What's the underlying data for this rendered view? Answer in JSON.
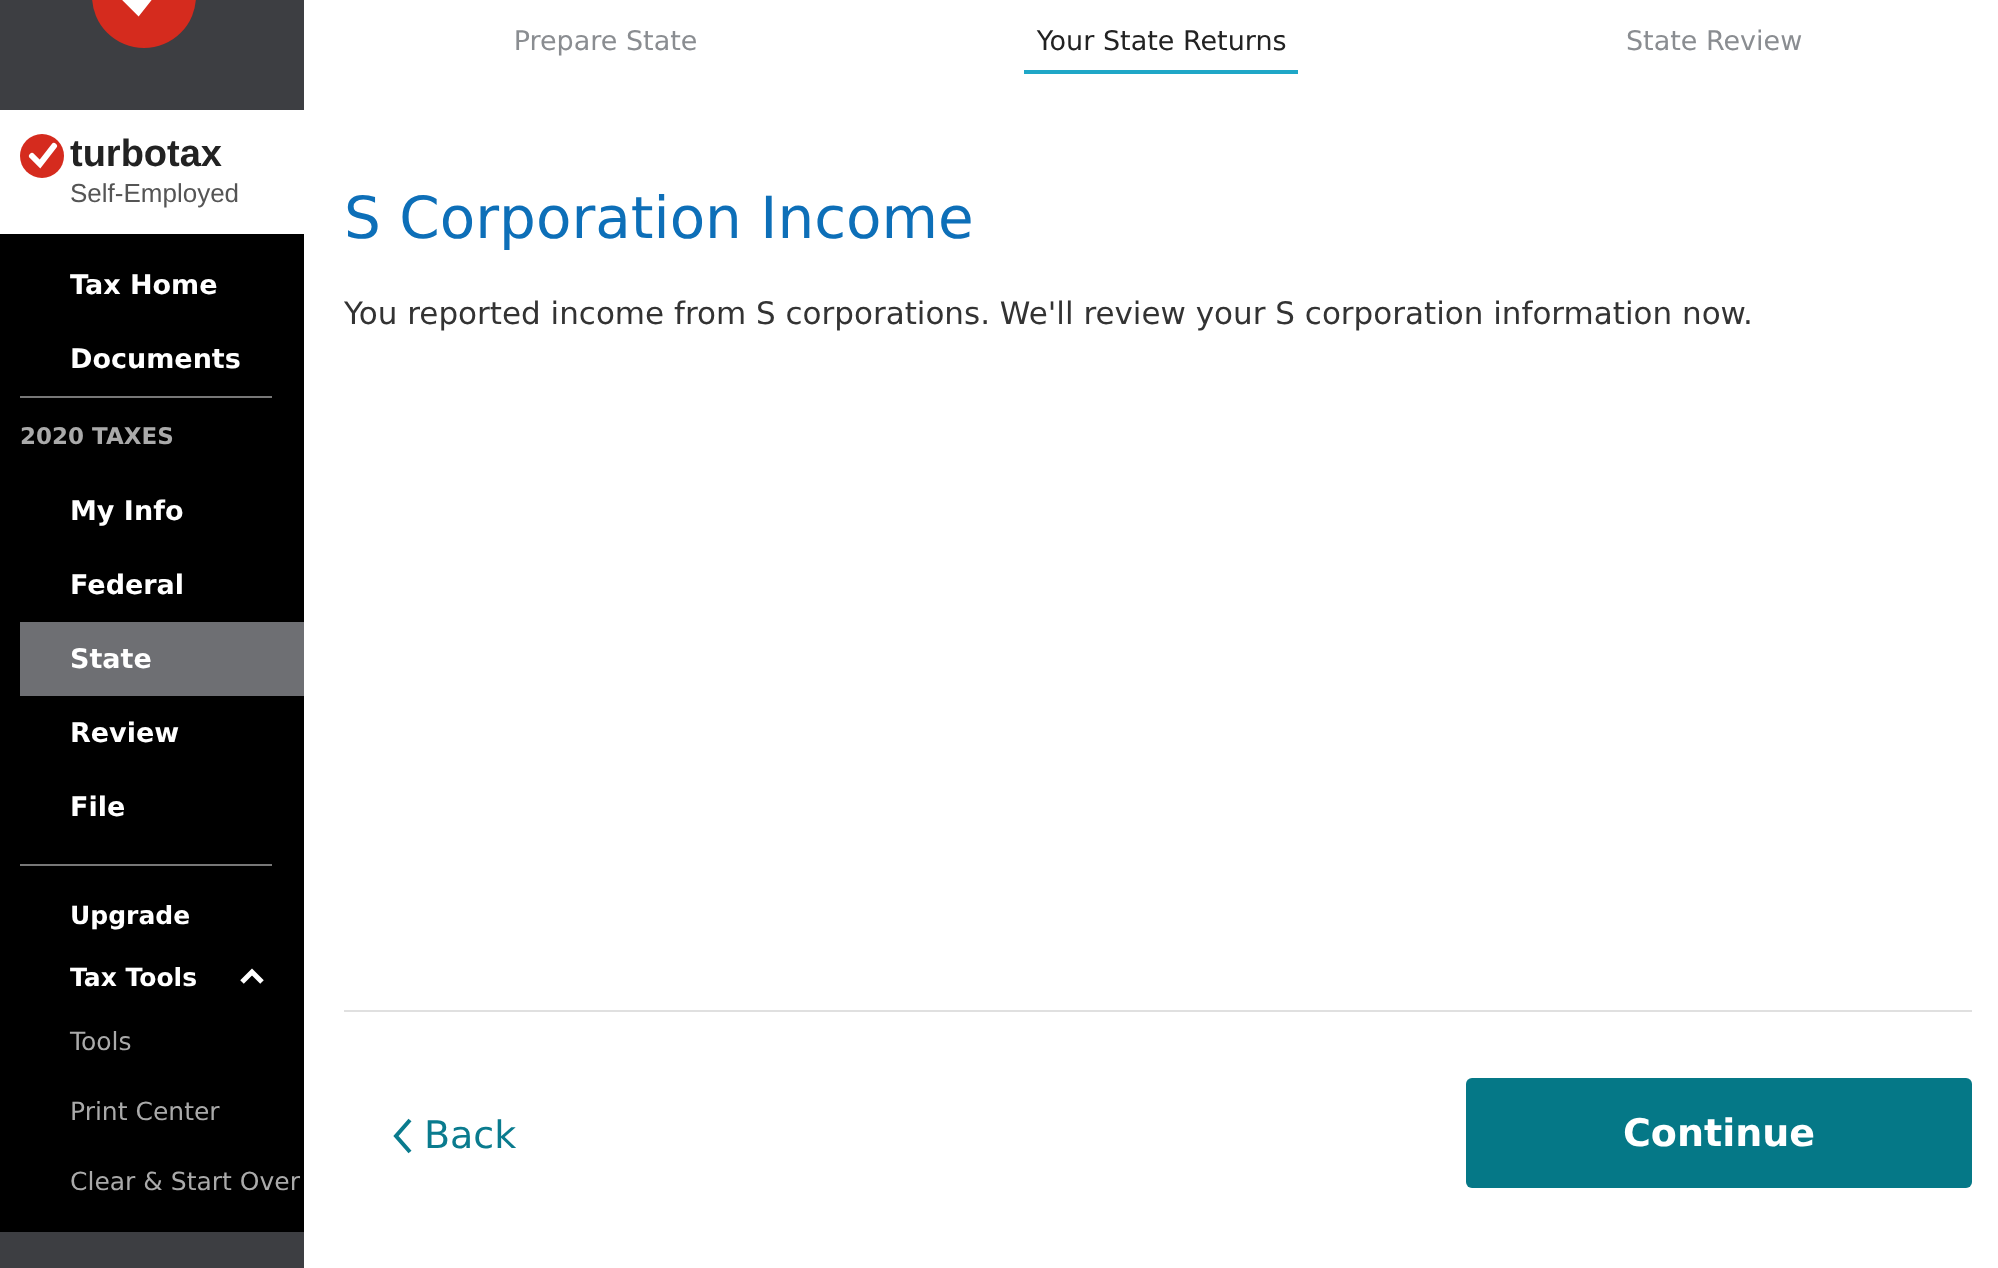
{
  "brand": {
    "name": "turbotax",
    "edition": "Self-Employed"
  },
  "sidebar": {
    "top_items": [
      {
        "label": "Tax Home",
        "selected": false
      },
      {
        "label": "Documents",
        "selected": false
      }
    ],
    "section": "2020 TAXES",
    "steps": [
      {
        "label": "My Info",
        "selected": false
      },
      {
        "label": "Federal",
        "selected": false
      },
      {
        "label": "State",
        "selected": true
      },
      {
        "label": "Review",
        "selected": false
      },
      {
        "label": "File",
        "selected": false
      }
    ],
    "upgrade": "Upgrade",
    "tax_tools": {
      "label": "Tax Tools",
      "expanded": true,
      "children": [
        {
          "label": "Tools"
        },
        {
          "label": "Print Center"
        },
        {
          "label": "Clear & Start Over"
        }
      ]
    }
  },
  "tabs": [
    {
      "label": "Prepare State",
      "selected": false
    },
    {
      "label": "Your State Returns",
      "selected": true
    },
    {
      "label": "State Review",
      "selected": false
    }
  ],
  "title": "S Corporation Income",
  "message": "You reported income from S corporations. We'll review your S corporation information now.",
  "buttons": {
    "back": "Back",
    "continue": "Continue"
  }
}
